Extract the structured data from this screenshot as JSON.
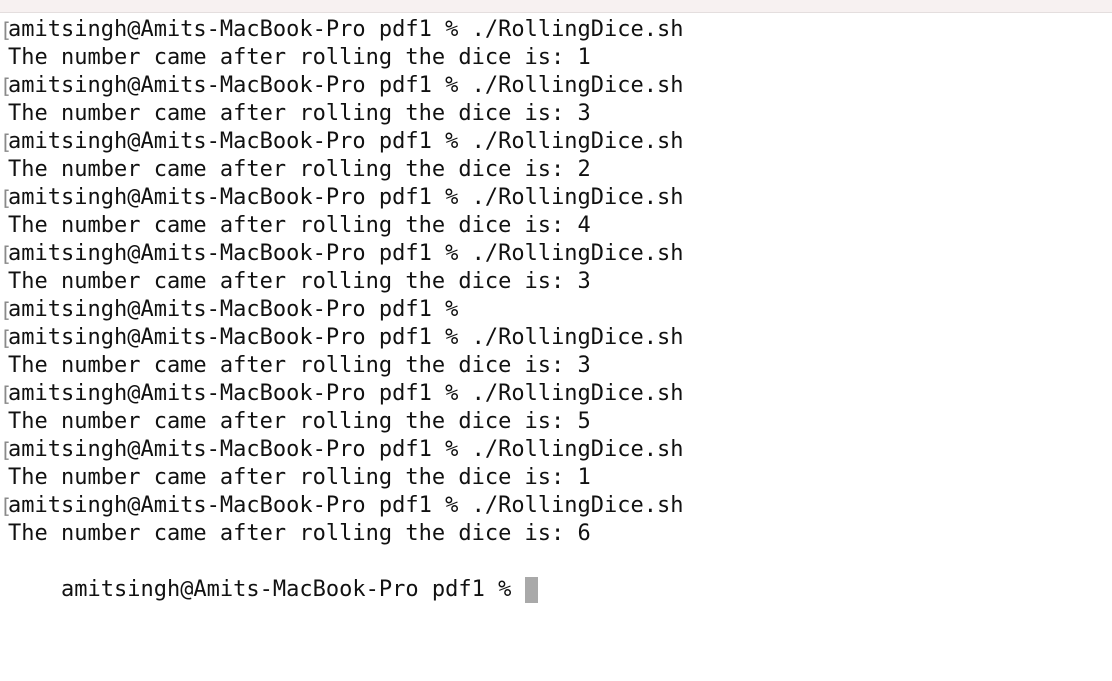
{
  "terminal": {
    "prompt": "amitsingh@Amits-MacBook-Pro pdf1 %",
    "lines": [
      {
        "type": "prompt",
        "command": "./RollingDice.sh",
        "bracket": "["
      },
      {
        "type": "output",
        "text": "The number came after rolling the dice is: 1"
      },
      {
        "type": "prompt",
        "command": "./RollingDice.sh",
        "bracket": "["
      },
      {
        "type": "output",
        "text": "The number came after rolling the dice is: 3"
      },
      {
        "type": "prompt",
        "command": "./RollingDice.sh",
        "bracket": "["
      },
      {
        "type": "output",
        "text": "The number came after rolling the dice is: 2"
      },
      {
        "type": "prompt",
        "command": "./RollingDice.sh",
        "bracket": "["
      },
      {
        "type": "output",
        "text": "The number came after rolling the dice is: 4"
      },
      {
        "type": "prompt",
        "command": "./RollingDice.sh",
        "bracket": "["
      },
      {
        "type": "output",
        "text": "The number came after rolling the dice is: 3"
      },
      {
        "type": "prompt",
        "command": "",
        "bracket": "["
      },
      {
        "type": "prompt",
        "command": "./RollingDice.sh",
        "bracket": "["
      },
      {
        "type": "output",
        "text": "The number came after rolling the dice is: 3"
      },
      {
        "type": "prompt",
        "command": "./RollingDice.sh",
        "bracket": "["
      },
      {
        "type": "output",
        "text": "The number came after rolling the dice is: 5"
      },
      {
        "type": "prompt",
        "command": "./RollingDice.sh",
        "bracket": "["
      },
      {
        "type": "output",
        "text": "The number came after rolling the dice is: 1"
      },
      {
        "type": "prompt",
        "command": "./RollingDice.sh",
        "bracket": "["
      },
      {
        "type": "output",
        "text": "The number came after rolling the dice is: 6"
      }
    ],
    "current_prompt": "amitsingh@Amits-MacBook-Pro pdf1 %",
    "cursor_color": "#a9a9a9"
  }
}
